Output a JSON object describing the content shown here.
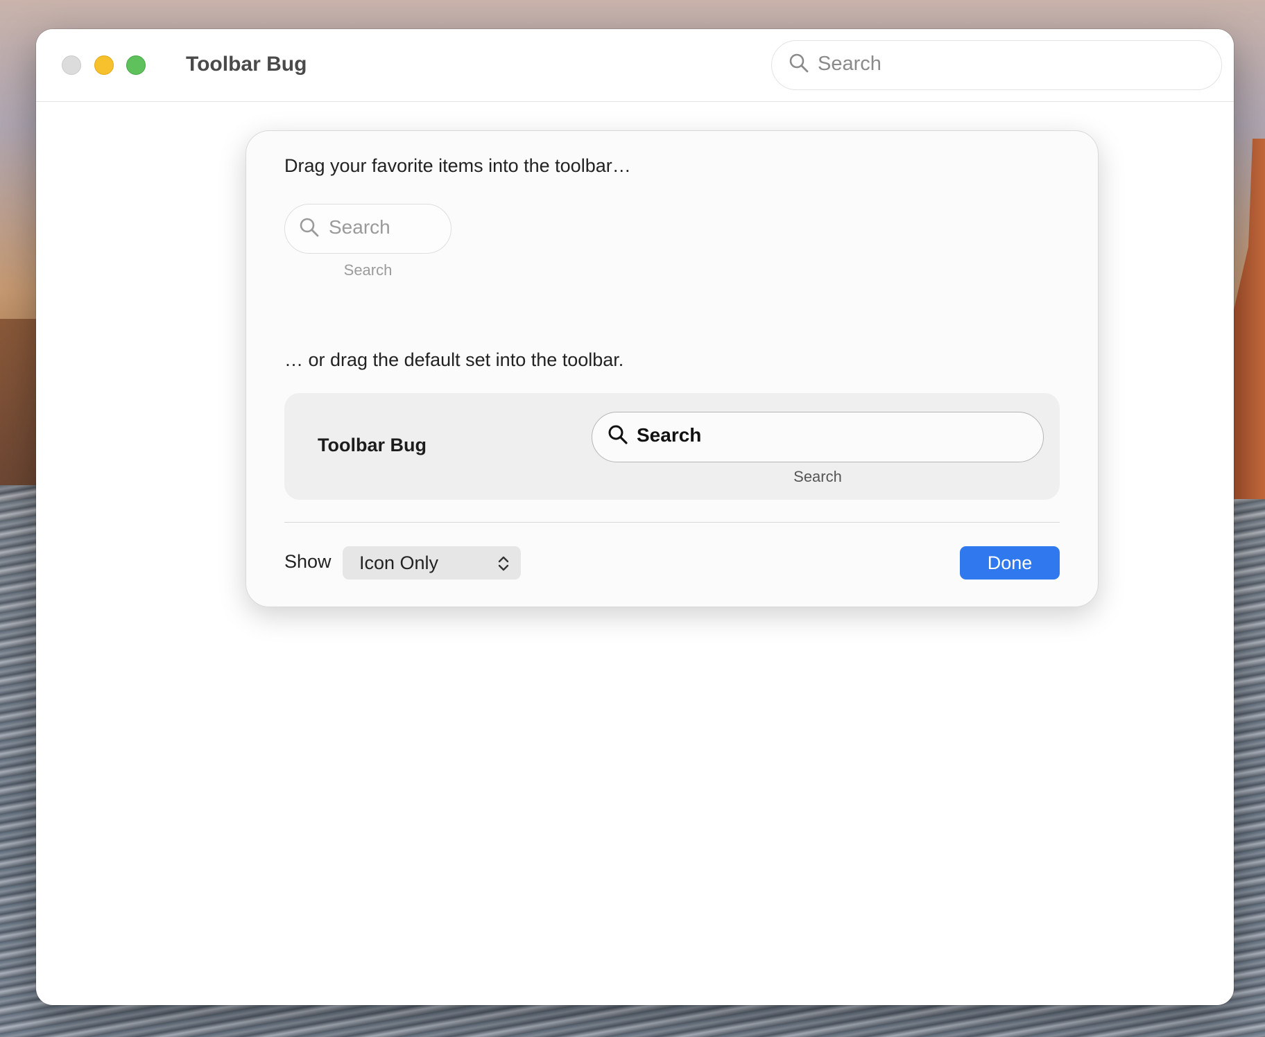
{
  "window": {
    "title": "Toolbar Bug",
    "search_placeholder": "Search"
  },
  "customize_sheet": {
    "drag_hint": "Drag your favorite items into the toolbar…",
    "items": [
      {
        "field_text": "Search",
        "label": "Search",
        "icon": "search-icon"
      }
    ],
    "default_hint": "… or drag the default set into the toolbar.",
    "default_set": {
      "title": "Toolbar Bug",
      "search_text": "Search",
      "search_label": "Search"
    },
    "show_label": "Show",
    "show_value": "Icon Only",
    "done_label": "Done"
  },
  "colors": {
    "accent": "#2f78ed",
    "close": "#dcdcdc",
    "minimize": "#f7c12e",
    "maximize": "#5ec15b"
  }
}
